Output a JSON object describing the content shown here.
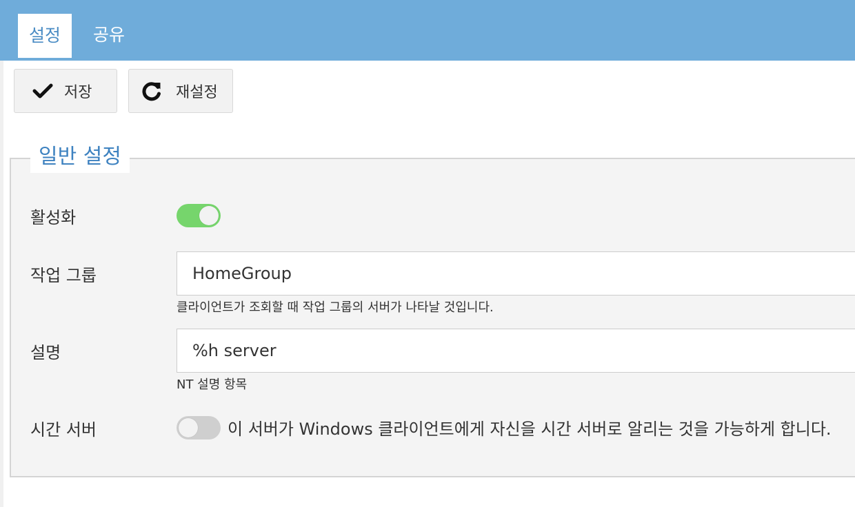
{
  "tabs": [
    {
      "label": "설정",
      "active": true
    },
    {
      "label": "공유",
      "active": false
    }
  ],
  "toolbar": {
    "save_label": "저장",
    "save_icon": "check-icon",
    "reset_label": "재설정",
    "reset_icon": "refresh-icon"
  },
  "general": {
    "legend": "일반 설정",
    "enable": {
      "label": "활성화",
      "state": "on"
    },
    "workgroup": {
      "label": "작업 그룹",
      "value": "HomeGroup",
      "help": "클라이언트가 조회할 때 작업 그룹의 서버가 나타날 것입니다."
    },
    "description": {
      "label": "설명",
      "value": "%h server",
      "help": "NT 설명 항목"
    },
    "timeserver": {
      "label": "시간 서버",
      "state": "off",
      "text": "이 서버가 Windows 클라이언트에게 자신을 시간 서버로 알리는 것을 가능하게 합니다."
    }
  },
  "colors": {
    "header": "#6facda",
    "accent": "#3e82c0",
    "toggle_on": "#76d56c",
    "toggle_off": "#cfcfcf"
  }
}
